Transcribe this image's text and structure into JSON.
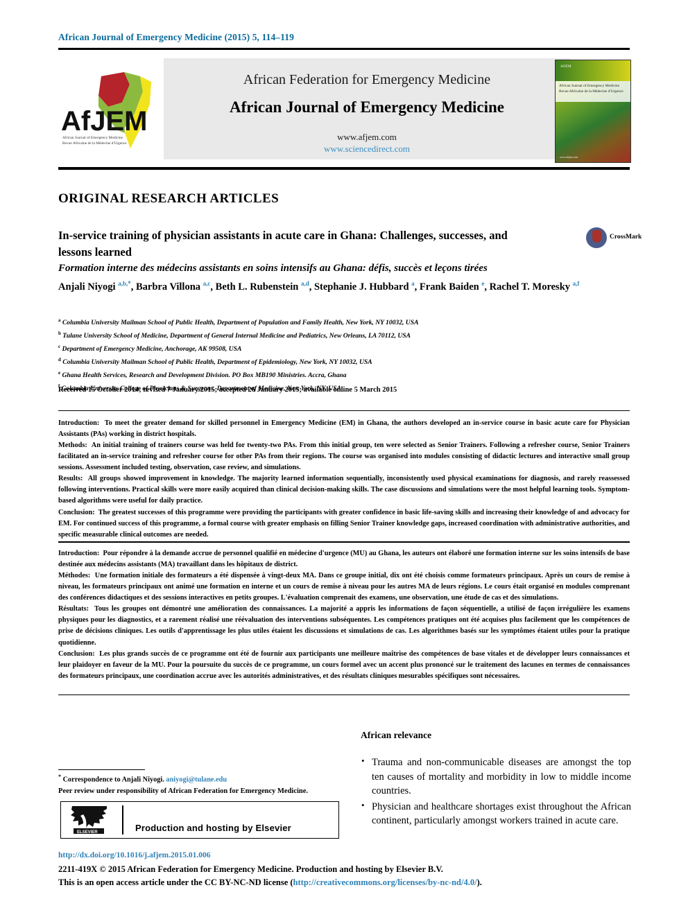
{
  "running_head": "African Journal of Emergency Medicine (2015) 5, 114–119",
  "masthead": {
    "federation": "African Federation for Emergency Medicine",
    "journal": "African Journal of Emergency Medicine",
    "url_journal": "www.afjem.com",
    "url_sciencedirect": "www.sciencedirect.com",
    "logo_text": "AfJEM",
    "logo_tagline_line1": "African Journal of Emergency Medicine",
    "logo_tagline_line2": "Revue Africaine de la Médecine d'Urgence",
    "cover_title_line1": "African Journal of Emergency Medicine",
    "cover_title_line2": "Revue Africaine de la Médecine d'Urgence",
    "cover_logo": "AfJEM",
    "cover_url": "www.afjem.com"
  },
  "section_head": "ORIGINAL RESEARCH ARTICLES",
  "article": {
    "title": "In-service training of physician assistants in acute care in Ghana: Challenges, successes, and lessons learned",
    "subtitle": "Formation interne des médecins assistants en soins intensifs au Ghana: défis, succès et leçons tirées",
    "crossmark_label": "CrossMark"
  },
  "authors": [
    {
      "name": "Anjali Niyogi",
      "sup": "a,b,*"
    },
    {
      "name": "Barbra Villona",
      "sup": "a,c"
    },
    {
      "name": "Beth L. Rubenstein",
      "sup": "a,d"
    },
    {
      "name": "Stephanie J. Hubbard",
      "sup": "a"
    },
    {
      "name": "Frank Baiden",
      "sup": "e"
    },
    {
      "name": "Rachel T. Moresky",
      "sup": "a,f"
    }
  ],
  "affiliations": [
    {
      "mark": "a",
      "text": "Columbia University Mailman School of Public Health, Department of Population and Family Health, New York, NY 10032, USA"
    },
    {
      "mark": "b",
      "text": "Tulane University School of Medicine, Department of General Internal Medicine and Pediatrics, New Orleans, LA 70112, USA"
    },
    {
      "mark": "c",
      "text": "Department of Emergency Medicine, Anchorage, AK 99508, USA"
    },
    {
      "mark": "d",
      "text": "Columbia University Mailman School of Public Health, Department of Epidemiology, New York, NY 10032, USA"
    },
    {
      "mark": "e",
      "text": "Ghana Health Services, Research and Development Division. PO Box MB190 Ministries. Accra, Ghana"
    },
    {
      "mark": "f",
      "text": "Columbia University College of Physicians & Surgeons, Department of Medicine, New York, NY, USA"
    }
  ],
  "received_line": "Received 15 October 2014; revised 7 January 2015; accepted 26 January 2015; available online 5 March 2015",
  "abstract_en": {
    "introduction_label": "Introduction:",
    "introduction": "To meet the greater demand for skilled personnel in Emergency Medicine (EM) in Ghana, the authors developed an in-service course in basic acute care for Physician Assistants (PAs) working in district hospitals.",
    "methods_label": "Methods:",
    "methods": "An initial training of trainers course was held for twenty-two PAs. From this initial group, ten were selected as Senior Trainers. Following a refresher course, Senior Trainers facilitated an in-service training and refresher course for other PAs from their regions. The course was organised into modules consisting of didactic lectures and interactive small group sessions. Assessment included testing, observation, case review, and simulations.",
    "results_label": "Results:",
    "results": "All groups showed improvement in knowledge. The majority learned information sequentially, inconsistently used physical examinations for diagnosis, and rarely reassessed following interventions. Practical skills were more easily acquired than clinical decision-making skills. The case discussions and simulations were the most helpful learning tools. Symptom-based algorithms were useful for daily practice.",
    "conclusion_label": "Conclusion:",
    "conclusion": "The greatest successes of this programme were providing the participants with greater confidence in basic life-saving skills and increasing their knowledge of and advocacy for EM. For continued success of this programme, a formal course with greater emphasis on filling Senior Trainer knowledge gaps, increased coordination with administrative authorities, and specific measurable clinical outcomes are needed."
  },
  "abstract_fr": {
    "introduction_label": "Introduction:",
    "introduction": "Pour répondre à la demande accrue de personnel qualifié en médecine d'urgence (MU) au Ghana, les auteurs ont élaboré une formation interne sur les soins intensifs de base destinée aux médecins assistants (MA) travaillant dans les hôpitaux de district.",
    "methods_label": "Méthodes:",
    "methods": "Une formation initiale des formateurs a été dispensée à vingt-deux MA. Dans ce groupe initial, dix ont été choisis comme formateurs principaux. Après un cours de remise à niveau, les formateurs principaux ont animé une formation en interne et un cours de remise à niveau pour les autres MA de leurs régions. Le cours était organisé en modules comprenant des conférences didactiques et des sessions interactives en petits groupes. L'évaluation comprenait des examens, une observation, une étude de cas et des simulations.",
    "results_label": "Résultats:",
    "results": "Tous les groupes ont démontré une amélioration des connaissances. La majorité a appris les informations de façon séquentielle, a utilisé de façon irrégulière les examens physiques pour les diagnostics, et a rarement réalisé une réévaluation des interventions subséquentes. Les compétences pratiques ont été acquises plus facilement que les compétences de prise de décisions cliniques. Les outils d'apprentissage les plus utiles étaient les discussions et simulations de cas. Les algorithmes basés sur les symptômes étaient utiles pour la pratique quotidienne.",
    "conclusion_label": "Conclusion:",
    "conclusion": "Les plus grands succès de ce programme ont été de fournir aux participants une meilleure maîtrise des compétences de base vitales et de développer leurs connaissances et leur plaidoyer en faveur de la MU. Pour la poursuite du succès de ce programme, un cours formel avec un accent plus prononcé sur le traitement des lacunes en termes de connaissances des formateurs principaux, une coordination accrue avec les autorités administratives, et des résultats cliniques mesurables spécifiques sont nécessaires."
  },
  "african_relevance": {
    "title": "African relevance",
    "bullets": [
      "Trauma and non-communicable diseases are amongst the top ten causes of mortality and morbidity in low to middle income countries.",
      "Physician and healthcare shortages exist throughout the African continent, particularly amongst workers trained in acute care."
    ]
  },
  "correspondence": {
    "mark": "*",
    "text": "Correspondence to Anjali Niyogi.",
    "email": "aniyogi@tulane.edu",
    "peer_review": "Peer review under responsibility of African Federation for Emergency Medicine."
  },
  "elsevier_box": {
    "label": "Production and hosting by Elsevier",
    "logo_word": "ELSEVIER"
  },
  "footer": {
    "doi": "http://dx.doi.org/10.1016/j.afjem.2015.01.006",
    "copyright_line": "2211-419X © 2015 African Federation for Emergency Medicine. Production and hosting by Elsevier B.V.",
    "license_prefix": "This is an open access article under the CC BY-NC-ND license (",
    "license_url": "http://creativecommons.org/licenses/by-nc-nd/4.0/",
    "license_suffix": ")."
  },
  "colors": {
    "link_blue": "#2f82b8",
    "runhead_blue": "#0b6a9b",
    "masthead_grey": "#e9e9e9"
  }
}
